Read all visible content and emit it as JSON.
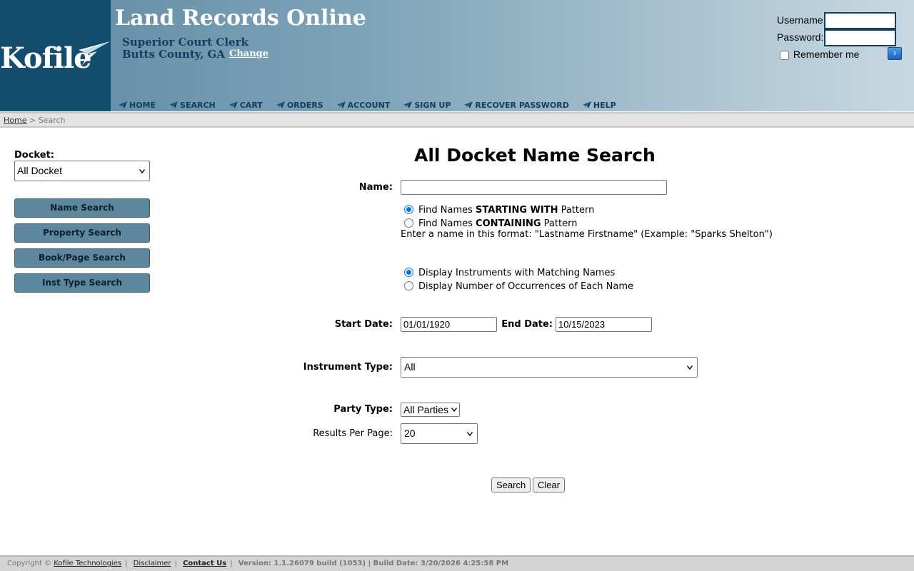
{
  "brand": {
    "logo_text": "Kofile",
    "site_title": "Land Records Online",
    "org_line1": "Superior Court Clerk",
    "org_line2": "Butts County, GA",
    "change_label": "Change"
  },
  "login": {
    "username_label": "Username:",
    "password_label": "Password:",
    "remember_label": "Remember me",
    "go_icon": "arrow-right-icon"
  },
  "nav": [
    {
      "label": "HOME"
    },
    {
      "label": "SEARCH"
    },
    {
      "label": "CART"
    },
    {
      "label": "ORDERS"
    },
    {
      "label": "ACCOUNT"
    },
    {
      "label": "SIGN UP"
    },
    {
      "label": "RECOVER PASSWORD"
    },
    {
      "label": "HELP"
    }
  ],
  "breadcrumb": {
    "home": "Home",
    "separator": ">",
    "current": "Search"
  },
  "sidebar": {
    "docket_label": "Docket:",
    "docket_value": "All Docket",
    "buttons": [
      {
        "label": "Name Search"
      },
      {
        "label": "Property Search"
      },
      {
        "label": "Book/Page Search"
      },
      {
        "label": "Inst Type Search"
      }
    ]
  },
  "form": {
    "title": "All Docket Name Search",
    "name_label": "Name:",
    "name_value": "",
    "match_options": [
      {
        "prefix": "Find Names ",
        "bold": "STARTING WITH",
        "suffix": " Pattern",
        "checked": true
      },
      {
        "prefix": "Find Names ",
        "bold": "CONTAINING",
        "suffix": " Pattern",
        "checked": false
      }
    ],
    "hint": "Enter a name in this format: \"Lastname Firstname\" (Example: \"Sparks Shelton\")",
    "display_options": [
      {
        "label": "Display Instruments with Matching Names",
        "checked": true
      },
      {
        "label": "Display Number of Occurrences of Each Name",
        "checked": false
      }
    ],
    "start_date_label": "Start Date:",
    "start_date": "01/01/1920",
    "end_date_label": "End Date:",
    "end_date": "10/15/2023",
    "instrument_type_label": "Instrument Type:",
    "instrument_type": "All",
    "party_type_label": "Party Type:",
    "party_type": "All Parties",
    "results_per_page_label": "Results Per Page:",
    "results_per_page": "20",
    "search_button": "Search",
    "clear_button": "Clear"
  },
  "footer": {
    "copyright": "Copyright ©",
    "company_link": "Kofile Technologies",
    "disclaimer_link": "Disclaimer",
    "contact_link": "Contact Us",
    "version": "Version: 1.1.26079 build (1053) | Build Date: 3/20/2026 4:25:58 PM"
  }
}
